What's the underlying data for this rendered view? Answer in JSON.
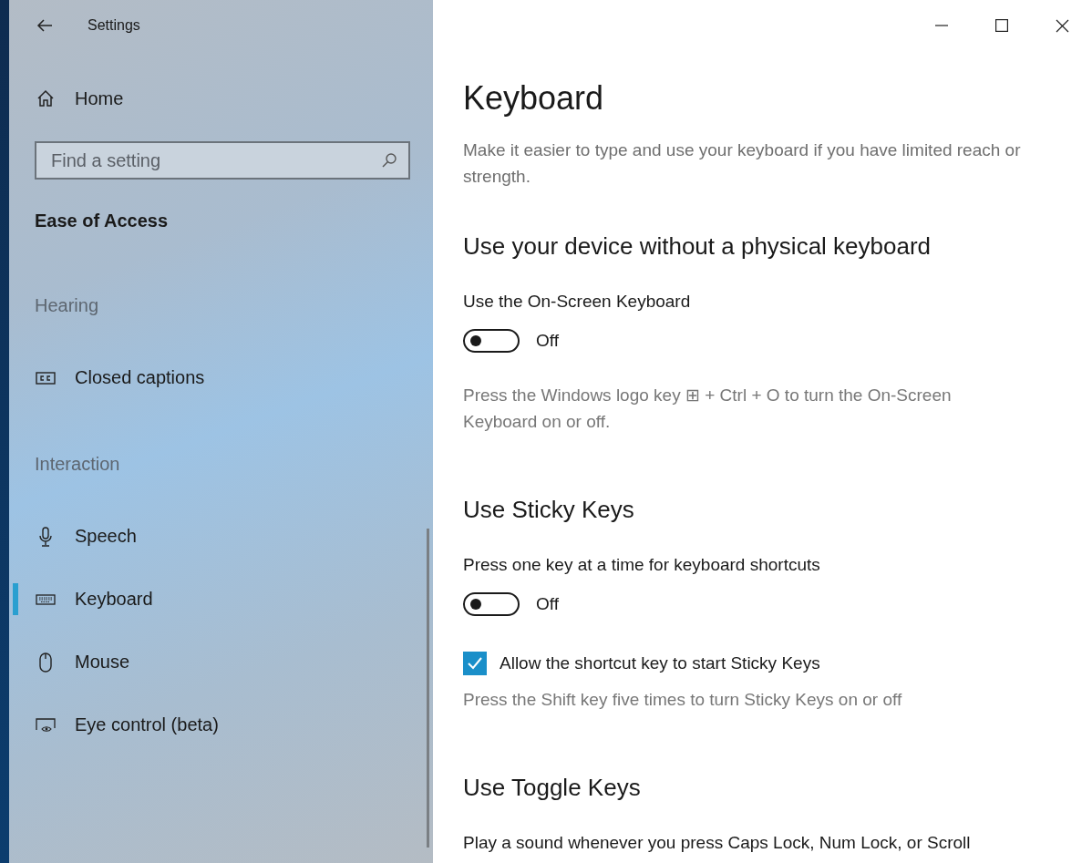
{
  "sidebar": {
    "title": "Settings",
    "home": "Home",
    "search": {
      "placeholder": "Find a setting"
    },
    "section_title": "Ease of Access",
    "groups": [
      {
        "label": "Hearing",
        "items": [
          {
            "kind": "captions",
            "label": "Closed captions",
            "selected": false
          }
        ]
      },
      {
        "label": "Interaction",
        "items": [
          {
            "kind": "microphone",
            "label": "Speech",
            "selected": false
          },
          {
            "kind": "keyboard",
            "label": "Keyboard",
            "selected": true
          },
          {
            "kind": "mouse",
            "label": "Mouse",
            "selected": false
          },
          {
            "kind": "eye",
            "label": "Eye control (beta)",
            "selected": false
          }
        ]
      }
    ]
  },
  "page": {
    "title": "Keyboard",
    "description": "Make it easier to type and use your keyboard if you have limited reach or strength.",
    "sections": [
      {
        "heading": "Use your device without a physical keyboard",
        "items": [
          {
            "kind": "toggle",
            "label": "Use the On-Screen Keyboard",
            "on": false,
            "state": "Off"
          },
          {
            "kind": "note",
            "text": "Press the Windows logo key ⊞ + Ctrl + O to turn the On-Screen Keyboard on or off."
          }
        ]
      },
      {
        "heading": "Use Sticky Keys",
        "items": [
          {
            "kind": "toggle",
            "label": "Press one key at a time for keyboard shortcuts",
            "on": false,
            "state": "Off"
          },
          {
            "kind": "checkbox",
            "label": "Allow the shortcut key to start Sticky Keys",
            "checked": true
          },
          {
            "kind": "hint",
            "text": "Press the Shift key five times to turn Sticky Keys on or off"
          }
        ]
      },
      {
        "heading": "Use Toggle Keys",
        "items": [
          {
            "kind": "label",
            "text": "Play a sound whenever you press Caps Lock, Num Lock, or Scroll"
          }
        ]
      }
    ]
  }
}
